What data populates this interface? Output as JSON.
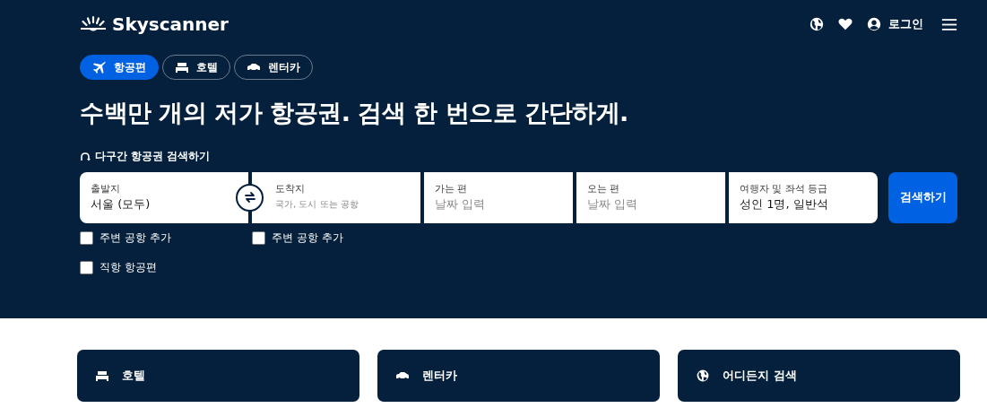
{
  "header": {
    "logo": "Skyscanner",
    "login": "로그인"
  },
  "tabs": [
    {
      "label": "항공편",
      "kind": "plane",
      "selected": true
    },
    {
      "label": "호텔",
      "kind": "bed",
      "selected": false
    },
    {
      "label": "렌터카",
      "kind": "car",
      "selected": false
    }
  ],
  "headline": "수백만 개의 저가 항공권. 검색 한 번으로 간단하게.",
  "multi_city": "다구간 항공권 검색하기",
  "fields": [
    {
      "kind": "place",
      "label": "출발지",
      "value": "서울 (모두)"
    },
    {
      "kind": "place",
      "label": "도착지",
      "placeholder": "국가, 도시 또는 공항"
    },
    {
      "kind": "date",
      "label": "가는 편",
      "placeholder": "날짜 입력"
    },
    {
      "kind": "date",
      "label": "오는 편",
      "placeholder": "날짜 입력"
    },
    {
      "kind": "travellers",
      "label": "여행자 및 좌석 등급",
      "value": "성인 1명, 일반석"
    }
  ],
  "search_button": "검색하기",
  "options": [
    {
      "label": "주변 공항 추가",
      "checked": false
    },
    {
      "label": "주변 공항 추가",
      "checked": false
    },
    {
      "label": "직항 항공편",
      "checked": false
    }
  ],
  "cards": [
    {
      "label": "호텔",
      "kind": "bed"
    },
    {
      "label": "렌터카",
      "kind": "car"
    },
    {
      "label": "어디든지 검색",
      "kind": "globe"
    }
  ]
}
